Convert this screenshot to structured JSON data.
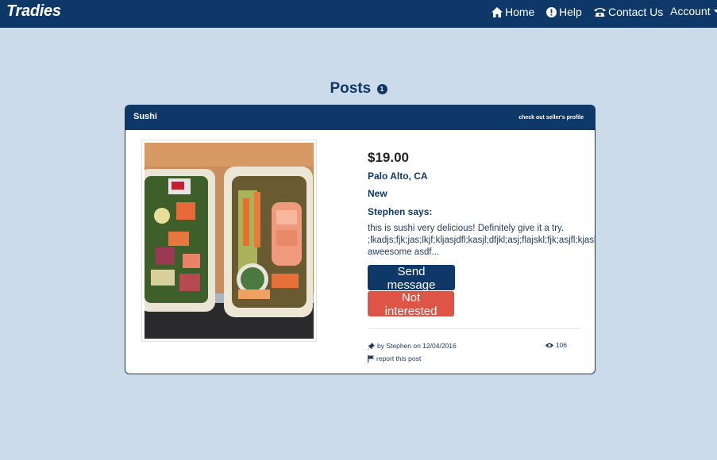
{
  "navbar": {
    "brand": "Tradies",
    "home_label": "Home",
    "help_label": "Help",
    "contact_label": "Contact Us",
    "account_label": "Account",
    "bg_color": "#0e3868"
  },
  "page": {
    "heading": "Posts",
    "count_badge": "1"
  },
  "post": {
    "title": "Sushi",
    "seller_link": "check out seller's profile",
    "price": "$19.00",
    "location": "Palo Alto, CA",
    "condition": "New",
    "author_says": "Stephen says:",
    "description": "this is sushi very delicious! Definitely give it a try. ;lkadjs;fjk;jas;lkjf;kljasjdfl;kasjl;dfjkl;asj;flajskl;fjk;asjfl;kjaskl;fklja aweesome asdf...",
    "send_button": "Send message",
    "not_interested_button": "Not interested",
    "byline": "by Stephen on 12/04/2016",
    "report_link": "report this post",
    "views": "106",
    "image_icon": "food-photo-sushi-salad-containers"
  },
  "colors": {
    "page_bg": "#ccdbea",
    "primary": "#0e3868",
    "danger": "#de5446"
  }
}
